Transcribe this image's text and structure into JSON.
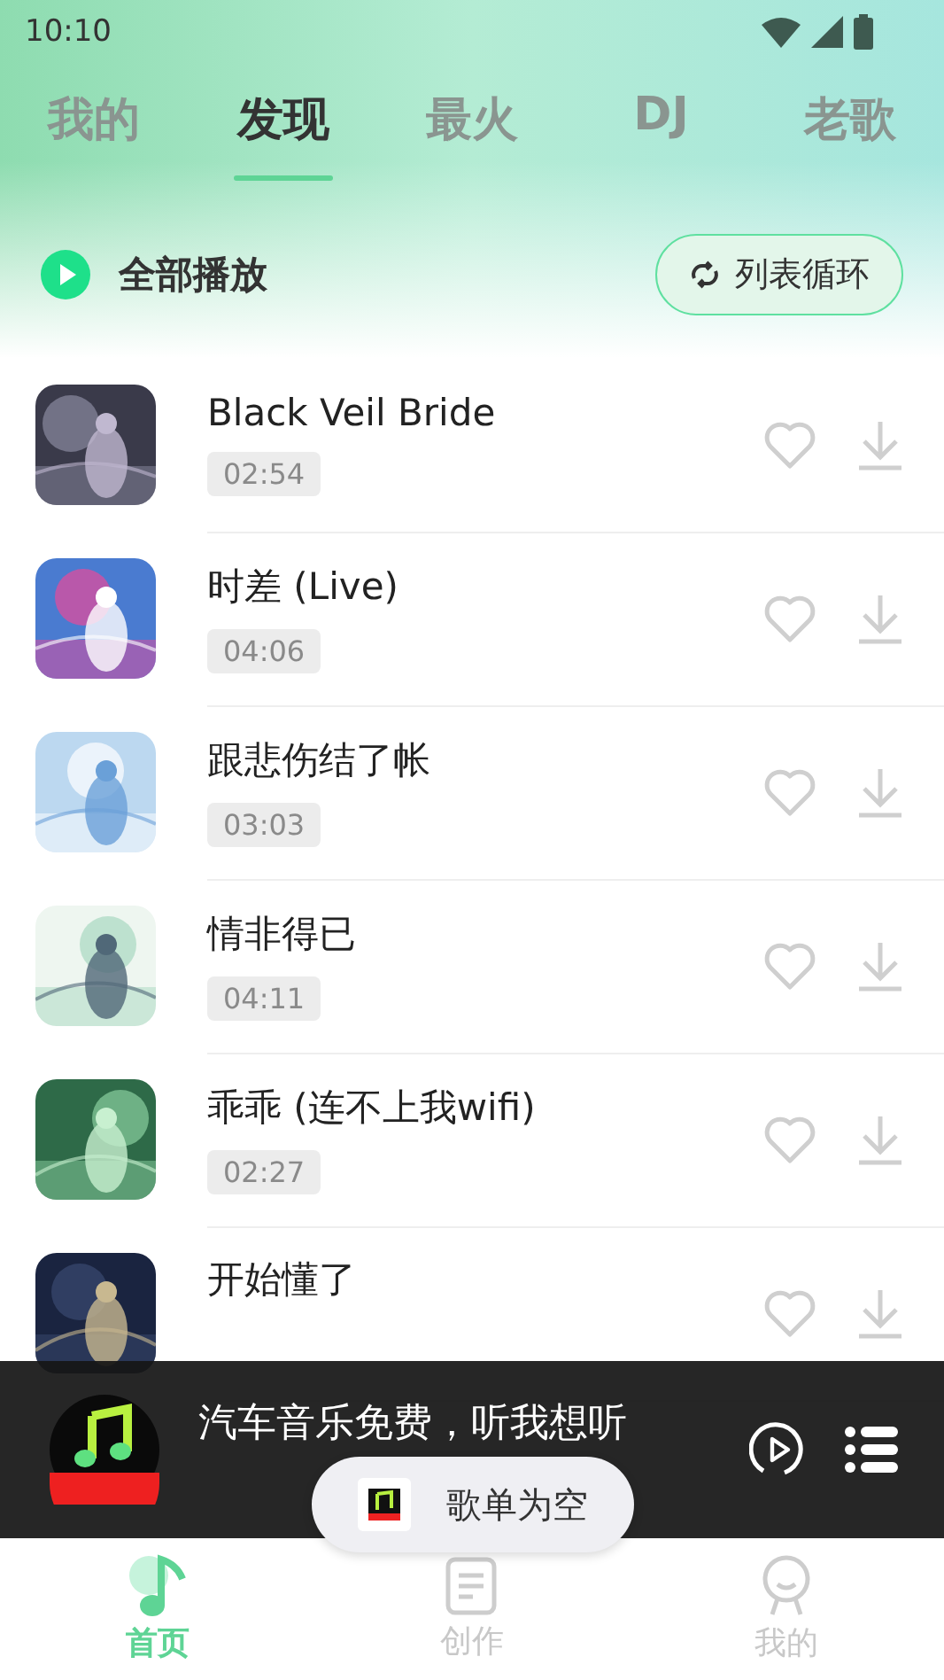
{
  "status_bar": {
    "time": "10:10"
  },
  "tabs": [
    {
      "label": "我的",
      "selected": false
    },
    {
      "label": "发现",
      "selected": true
    },
    {
      "label": "最火",
      "selected": false
    },
    {
      "label": "DJ",
      "selected": false
    },
    {
      "label": "老歌",
      "selected": false
    }
  ],
  "play_all": {
    "label": "全部播放"
  },
  "loop_mode": {
    "label": "列表循环"
  },
  "songs": [
    {
      "title": "Black Veil Bride",
      "duration": "02:54"
    },
    {
      "title": "时差 (Live)",
      "duration": "04:06"
    },
    {
      "title": "跟悲伤结了帐",
      "duration": "03:03"
    },
    {
      "title": "情非得已",
      "duration": "04:11"
    },
    {
      "title": "乖乖 (连不上我wifi)",
      "duration": "02:27"
    },
    {
      "title": "开始懂了"
    }
  ],
  "player": {
    "title": "汽车音乐免费，听我想听"
  },
  "toast": {
    "text": "歌单为空"
  },
  "bottom_nav": [
    {
      "label": "首页",
      "selected": true
    },
    {
      "label": "创作",
      "selected": false
    },
    {
      "label": "我的",
      "selected": false
    }
  ]
}
